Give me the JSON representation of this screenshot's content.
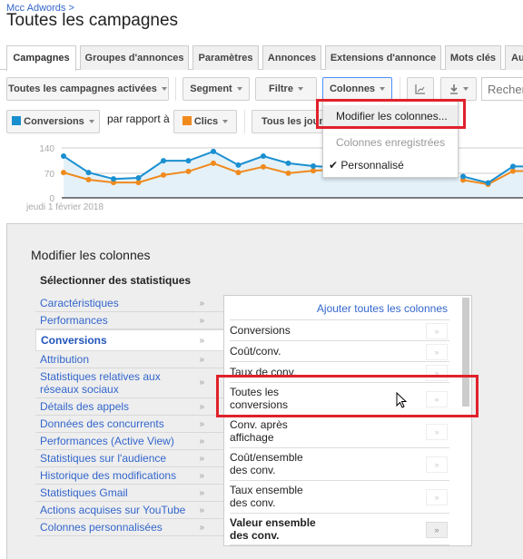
{
  "header": {
    "breadcrumb": "Mcc Adwords >",
    "title": "Toutes les campagnes"
  },
  "tabs": [
    {
      "label": "Campagnes",
      "active": true
    },
    {
      "label": "Groupes d'annonces"
    },
    {
      "label": "Paramètres"
    },
    {
      "label": "Annonces"
    },
    {
      "label": "Extensions d'annonce"
    },
    {
      "label": "Mots clés"
    },
    {
      "label": "Audiences"
    }
  ],
  "toolbar": {
    "campaign_filter": "Toutes les campagnes activées",
    "segment": "Segment",
    "filter": "Filtre",
    "columns": "Colonnes",
    "search_placeholder": "Rechercher"
  },
  "metrics": {
    "metric1": {
      "label": "Conversions",
      "color": "#1a8fd0"
    },
    "compare_label": "par rapport à",
    "metric2": {
      "label": "Clics",
      "color": "#f08a1d"
    },
    "period": "Tous les jours"
  },
  "columns_menu": {
    "items": [
      "Modifier les colonnes...",
      "Colonnes enregistrées",
      "Personnalisé"
    ],
    "checked": "Personnalisé"
  },
  "chart_data": {
    "type": "line",
    "y_ticks": [
      "140",
      "70",
      "0"
    ],
    "ylim": [
      0,
      140
    ],
    "x_start_label": "jeudi 1 février 2018",
    "series": [
      {
        "name": "Conversions",
        "color": "#1a8fd0",
        "values": [
          117,
          71,
          53,
          56,
          104,
          104,
          130,
          92,
          117,
          97,
          89,
          85,
          null,
          null,
          null,
          null,
          60,
          42,
          88
        ]
      },
      {
        "name": "Clics",
        "color": "#f08a1d",
        "values": [
          71,
          51,
          43,
          43,
          64,
          74,
          97,
          71,
          87,
          69,
          76,
          80,
          null,
          null,
          null,
          null,
          50,
          38,
          75
        ]
      }
    ]
  },
  "modal": {
    "title": "Modifier les colonnes",
    "subtitle": "Sélectionner des statistiques",
    "categories": [
      "Caractéristiques",
      "Performances",
      "Conversions",
      "Attribution",
      "Statistiques relatives aux réseaux sociaux",
      "Détails des appels",
      "Données des concurrents",
      "Performances (Active View)",
      "Statistiques sur l'audience",
      "Historique des modifications",
      "Statistiques Gmail",
      "Actions acquises sur YouTube",
      "Colonnes personnalisées"
    ],
    "active_category": "Conversions",
    "add_all": "Ajouter toutes les colonnes",
    "columns": [
      "Conversions",
      "Coût/conv.",
      "Taux de conv.",
      "Toutes les conversions",
      "Conv. après affichage",
      "Coût/ensemble des conv.",
      "Taux ensemble des conv.",
      "Valeur ensemble des conv."
    ],
    "add_glyph": "»",
    "arrow_glyph": "»"
  }
}
